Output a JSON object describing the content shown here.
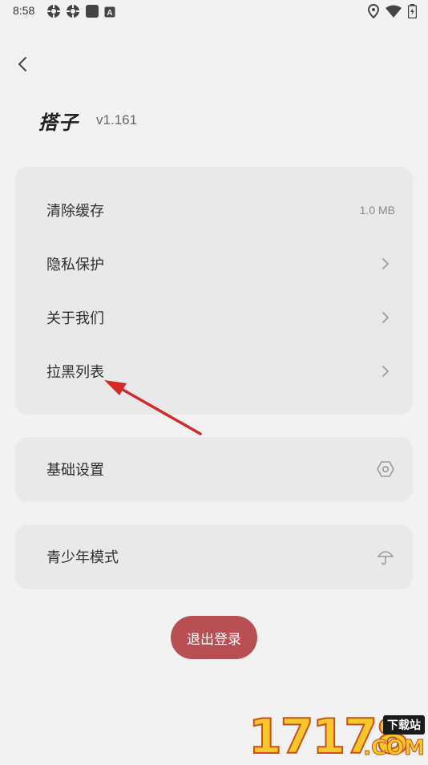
{
  "status_bar": {
    "time": "8:58",
    "left_icons": [
      "settings-gear-icon",
      "settings-gear-icon",
      "square-notification-icon",
      "keyboard-a-icon"
    ],
    "right_icons": [
      "location-pin-icon",
      "wifi-icon",
      "battery-charging-icon"
    ]
  },
  "header": {
    "back_icon": "chevron-left-icon",
    "app_name": "搭子",
    "version": "v1.161"
  },
  "main_list": [
    {
      "label": "清除缓存",
      "value": "1.0 MB"
    },
    {
      "label": "隐私保护",
      "icon": "chevron-right-icon"
    },
    {
      "label": "关于我们",
      "icon": "chevron-right-icon"
    },
    {
      "label": "拉黑列表",
      "icon": "chevron-right-icon"
    }
  ],
  "basic_settings": {
    "label": "基础设置",
    "icon": "hexagon-settings-icon"
  },
  "youth_mode": {
    "label": "青少年模式",
    "icon": "umbrella-icon"
  },
  "logout": {
    "label": "退出登录"
  },
  "watermark": {
    "digits": "17178",
    "badge": "下载站",
    "suffix": ".COM"
  },
  "colors": {
    "background": "#f2f2f2",
    "card": "#e9e9e9",
    "logout_button": "#b84f53",
    "annotation_arrow": "#d42a2a"
  }
}
